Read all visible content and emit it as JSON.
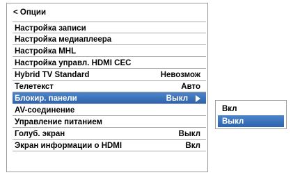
{
  "header": {
    "back_label": "< Опции"
  },
  "menu": {
    "items": [
      {
        "label": "Настройка записи",
        "value": ""
      },
      {
        "label": "Настройка медиаплеера",
        "value": ""
      },
      {
        "label": "Настройка MHL",
        "value": ""
      },
      {
        "label": "Настройка управл. HDMI CEC",
        "value": ""
      },
      {
        "label": "Hybrid TV Standard",
        "value": "Невозмож"
      },
      {
        "label": "Телетекст",
        "value": "Авто"
      },
      {
        "label": "Блокир. панели",
        "value": "Выкл"
      },
      {
        "label": "AV-соединение",
        "value": ""
      },
      {
        "label": "Управление питанием",
        "value": ""
      },
      {
        "label": "Голуб. экран",
        "value": "Выкл"
      },
      {
        "label": "Экран информации о HDMI",
        "value": "Вкл"
      }
    ],
    "selected_index": 6
  },
  "submenu": {
    "options": [
      "Вкл",
      "Выкл"
    ],
    "selected_index": 1
  },
  "colors": {
    "highlight": "#3a6fb8",
    "divider": "#aaaaaa",
    "border": "#9a9a9a"
  },
  "icons": {
    "submenu_arrow": "triangle-right-icon"
  }
}
